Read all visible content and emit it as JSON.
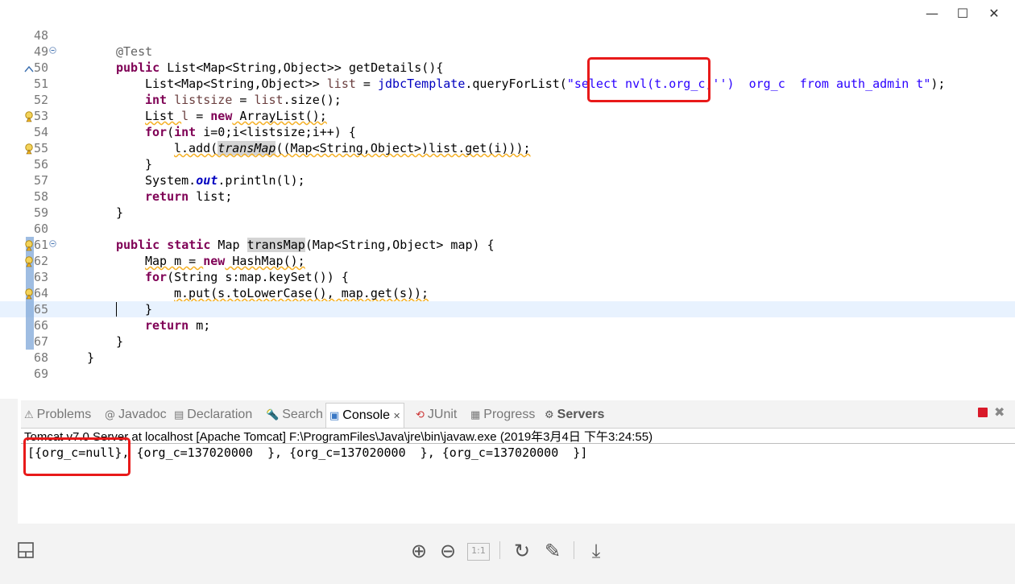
{
  "window": {
    "minimize": "—",
    "maximize": "☐",
    "close": "✕"
  },
  "editor": {
    "lines": [
      {
        "n": "48"
      },
      {
        "n": "49"
      },
      {
        "n": "50"
      },
      {
        "n": "51"
      },
      {
        "n": "52"
      },
      {
        "n": "53"
      },
      {
        "n": "54"
      },
      {
        "n": "55"
      },
      {
        "n": "56"
      },
      {
        "n": "57"
      },
      {
        "n": "58"
      },
      {
        "n": "59"
      },
      {
        "n": "60"
      },
      {
        "n": "61"
      },
      {
        "n": "62"
      },
      {
        "n": "63"
      },
      {
        "n": "64"
      },
      {
        "n": "65"
      },
      {
        "n": "66"
      },
      {
        "n": "67"
      },
      {
        "n": "68"
      },
      {
        "n": "69"
      }
    ],
    "code": {
      "l49_annotation": "@Test",
      "l50_public": "public",
      "l50_rest": " List<Map<String,Object>> getDetails(){",
      "l51_a": "List<Map<String,Object>> ",
      "l51_var": "list",
      "l51_b": " = ",
      "l51_field": "jdbcTemplate",
      "l51_c": ".queryForList(",
      "l51_str": "\"select nvl(t.org_c,'')  org_c  from auth_admin t\"",
      "l51_d": ");",
      "l52_int": "int",
      "l52_var": " listsize",
      "l52_b": " = ",
      "l52_var2": "list",
      "l52_c": ".size();",
      "l53_a": "List ",
      "l53_var": "l",
      "l53_b": " = ",
      "l53_new": "new",
      "l53_c": " ArrayList();",
      "l54_for": "for",
      "l54_a": "(",
      "l54_int": "int",
      "l54_b": " i=0;i<listsize;i++) {",
      "l55_a": "l.add(",
      "l55_method": "transMap",
      "l55_b": "((Map<String,Object>)list.get(i)));",
      "l56": "}",
      "l57_a": "System.",
      "l57_out": "out",
      "l57_b": ".println(l);",
      "l58_return": "return",
      "l58_a": " list;",
      "l59": "}",
      "l61_public": "public",
      "l61_static": "static",
      "l61_a": " Map ",
      "l61_method": "transMap",
      "l61_b": "(Map<String,Object> map) {",
      "l62_a": "Map m = ",
      "l62_new": "new",
      "l62_b": " HashMap();",
      "l63_for": "for",
      "l63_a": "(String s:map.keySet()) {",
      "l64": "m.put(s.toLowerCase(), map.get(s));",
      "l65": "}",
      "l66_return": "return",
      "l66_a": " m;",
      "l67": "}",
      "l68": "}"
    },
    "hscroll_arrow": "<"
  },
  "panel": {
    "tabs": [
      {
        "label": "Problems",
        "icon": "⚠"
      },
      {
        "label": "Javadoc",
        "icon": "@"
      },
      {
        "label": "Declaration",
        "icon": "▤"
      },
      {
        "label": "Search",
        "icon": "🔦"
      },
      {
        "label": "Console",
        "icon": "▣",
        "close": "✕"
      },
      {
        "label": "JUnit",
        "icon": "⟲"
      },
      {
        "label": "Progress",
        "icon": "▦"
      },
      {
        "label": "Servers",
        "icon": "⚙"
      }
    ],
    "remove_all": "✖",
    "console_description": "Tomcat v7.0 Server at localhost [Apache Tomcat] F:\\ProgramFiles\\Java\\jre\\bin\\javaw.exe (2019年3月4日 下午3:24:55)",
    "console_output": "[{org_c=null}, {org_c=137020000  }, {org_c=137020000  }, {org_c=137020000  }]"
  },
  "viewer": {
    "zoom_in": "⊕",
    "zoom_out": "⊖",
    "actual_size": "1:1",
    "rotate": "↻",
    "edit": "✎",
    "download": "⤓"
  },
  "colors": {
    "keyword": "#7f0055",
    "string": "#2a00ff",
    "field": "#0000c0",
    "annotation_box": "#e81a1a",
    "current_line": "#e8f2fe"
  }
}
